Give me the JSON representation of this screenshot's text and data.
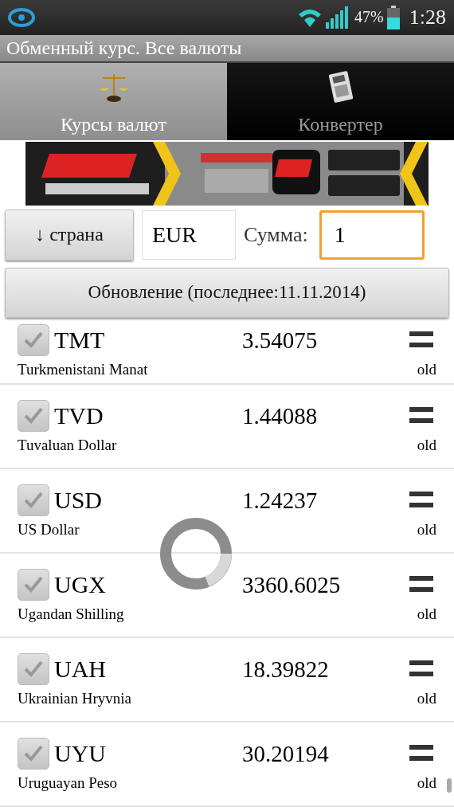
{
  "status_bar": {
    "battery": "47%",
    "time": "1:28"
  },
  "title": "Обменный курс. Все валюты",
  "tabs": [
    {
      "label": "Курсы валют",
      "selected": true,
      "kind": "scales"
    },
    {
      "label": "Конвертер",
      "selected": false,
      "kind": "calculator"
    }
  ],
  "controls": {
    "sort_button": "↓ страна",
    "currency": "EUR",
    "amount_label": "Сумма:",
    "amount_value": "1"
  },
  "update_button": "Обновление (последнее:11.11.2014)",
  "rates": [
    {
      "code": "TMT",
      "rate": "3.54075",
      "name": "Turkmenistani Manat",
      "checked": true,
      "status": "old"
    },
    {
      "code": "TVD",
      "rate": "1.44088",
      "name": "Tuvaluan Dollar",
      "checked": true,
      "status": "old"
    },
    {
      "code": "USD",
      "rate": "1.24237",
      "name": "US Dollar",
      "checked": true,
      "status": "old"
    },
    {
      "code": "UGX",
      "rate": "3360.6025",
      "name": "Ugandan Shilling",
      "checked": true,
      "status": "old"
    },
    {
      "code": "UAH",
      "rate": "18.39822",
      "name": "Ukrainian Hryvnia",
      "checked": true,
      "status": "old"
    },
    {
      "code": "UYU",
      "rate": "30.20194",
      "name": "Uruguayan Peso",
      "checked": true,
      "status": "old"
    }
  ],
  "loading": true
}
